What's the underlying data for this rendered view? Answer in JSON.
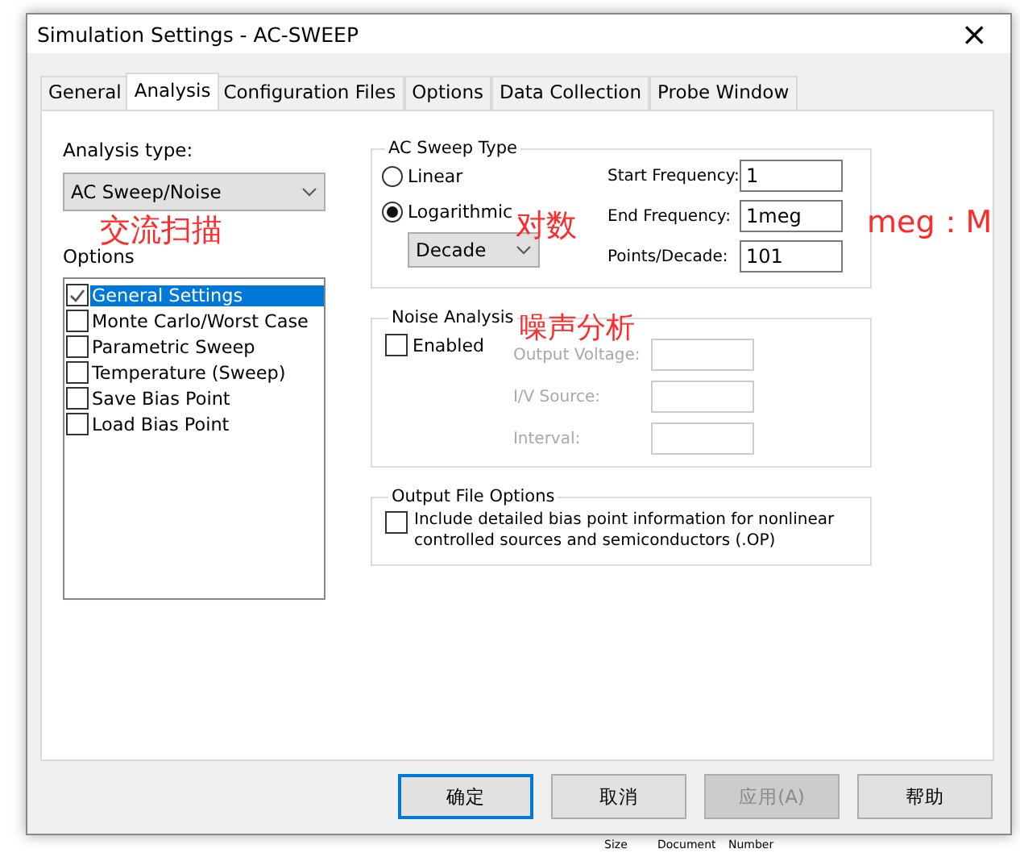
{
  "window": {
    "title": "Simulation Settings - AC-SWEEP",
    "close": "×"
  },
  "tabs": [
    {
      "label": "General",
      "selected": false
    },
    {
      "label": "Analysis",
      "selected": true
    },
    {
      "label": "Configuration Files",
      "selected": false
    },
    {
      "label": "Options",
      "selected": false
    },
    {
      "label": "Data Collection",
      "selected": false
    },
    {
      "label": "Probe Window",
      "selected": false
    }
  ],
  "analysis_type": {
    "label": "Analysis type:",
    "value": "AC Sweep/Noise"
  },
  "options": {
    "label": "Options",
    "items": [
      {
        "label": "General Settings",
        "checked": true,
        "selected": true
      },
      {
        "label": "Monte Carlo/Worst Case",
        "checked": false,
        "selected": false
      },
      {
        "label": "Parametric Sweep",
        "checked": false,
        "selected": false
      },
      {
        "label": "Temperature (Sweep)",
        "checked": false,
        "selected": false
      },
      {
        "label": "Save Bias Point",
        "checked": false,
        "selected": false
      },
      {
        "label": "Load Bias Point",
        "checked": false,
        "selected": false
      }
    ]
  },
  "ac_sweep_type": {
    "title": "AC Sweep Type",
    "radios": [
      {
        "label": "Linear",
        "selected": false
      },
      {
        "label": "Logarithmic",
        "selected": true
      }
    ],
    "scale": "Decade",
    "fields": [
      {
        "label": "Start Frequency:",
        "value": "1"
      },
      {
        "label": "End Frequency:",
        "value": "1meg"
      },
      {
        "label": "Points/Decade:",
        "value": "101"
      }
    ]
  },
  "noise_analysis": {
    "title": "Noise Analysis",
    "enabled_label": "Enabled",
    "enabled": false,
    "fields": [
      {
        "label": "Output Voltage:",
        "disabled": true
      },
      {
        "label": "I/V Source:",
        "disabled": true
      },
      {
        "label": "Interval:",
        "disabled": true
      }
    ]
  },
  "output_file_options": {
    "title": "Output File Options",
    "checkbox": {
      "label": "Include detailed bias point information for nonlinear controlled sources and semiconductors (.OP)",
      "checked": false
    }
  },
  "buttons": [
    {
      "label": "确定",
      "default": true,
      "disabled": false
    },
    {
      "label": "取消",
      "default": false,
      "disabled": false
    },
    {
      "label": "应用(A)",
      "default": false,
      "disabled": true
    },
    {
      "label": "帮助",
      "default": false,
      "disabled": false
    }
  ],
  "annotations": [
    "交流扫描",
    "对数",
    "meg：M",
    "噪声分析"
  ],
  "background_sheet": [
    "Size",
    "Document",
    "Number"
  ]
}
